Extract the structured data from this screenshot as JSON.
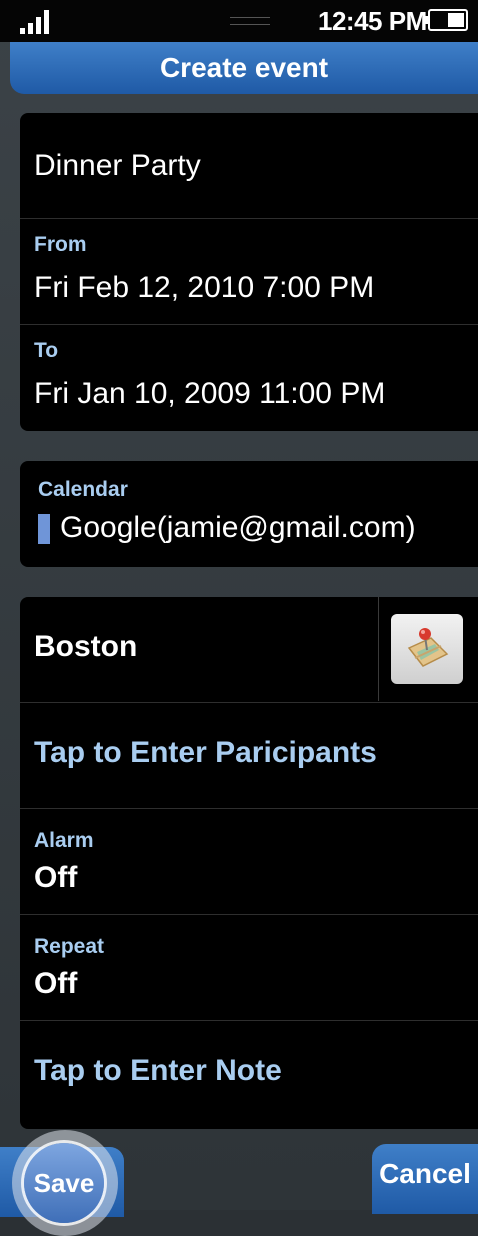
{
  "status": {
    "time": "12:45 PM"
  },
  "header": {
    "title": "Create event"
  },
  "event": {
    "title": "Dinner Party",
    "from_label": "From",
    "from_value": "Fri Feb 12, 2010 7:00 PM",
    "to_label": "To",
    "to_value": "Fri Jan 10, 2009 11:00 PM"
  },
  "calendar": {
    "label": "Calendar",
    "value": "Google(jamie@gmail.com)",
    "color": "#6f95d8"
  },
  "details": {
    "location": "Boston",
    "participants_prompt": "Tap to Enter Paricipants",
    "alarm_label": "Alarm",
    "alarm_value": "Off",
    "repeat_label": "Repeat",
    "repeat_value": "Off",
    "note_prompt": "Tap to Enter Note"
  },
  "buttons": {
    "save": "Save",
    "cancel": "Cancel"
  },
  "icons": {
    "map": "map-pin-icon",
    "signal": "signal-icon",
    "battery": "battery-icon"
  },
  "colors": {
    "accent": "#2a6ab8",
    "label": "#a9cdf0"
  }
}
